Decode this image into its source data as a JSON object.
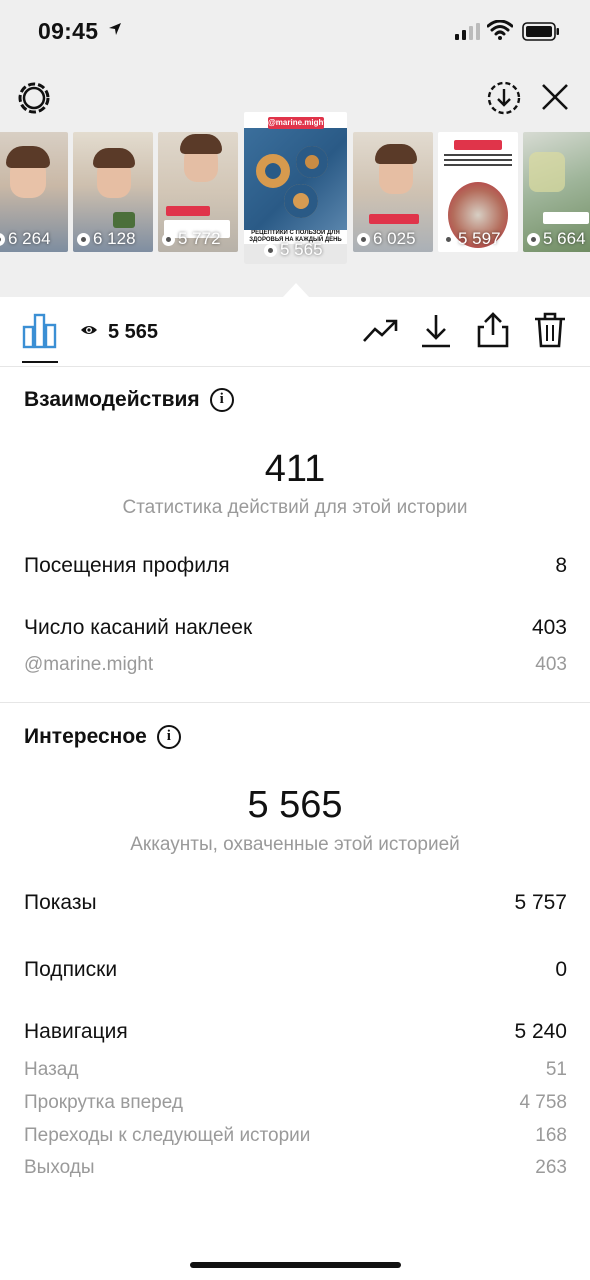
{
  "status_bar": {
    "time": "09:45"
  },
  "stories": [
    {
      "views": "6 264"
    },
    {
      "views": "6 128"
    },
    {
      "views": "5 772"
    },
    {
      "views": "5 565",
      "active": true,
      "tag": "@marine.might",
      "caption": "РЕЦЕПТИКИ С ПОЛЬЗОЙ ДЛЯ ЗДОРОВЬЯ НА КАЖДЫЙ ДЕНЬ"
    },
    {
      "views": "6 025"
    },
    {
      "views": "5 597"
    },
    {
      "views": "5 664"
    }
  ],
  "toolbar": {
    "views_count": "5 565"
  },
  "interactions": {
    "title": "Взаимодействия",
    "total": "411",
    "caption": "Статистика действий для этой истории",
    "rows": [
      {
        "label": "Посещения профиля",
        "value": "8"
      },
      {
        "label": "Число касаний наклеек",
        "value": "403"
      }
    ],
    "sub_rows": [
      {
        "label": "@marine.might",
        "value": "403"
      }
    ]
  },
  "discovery": {
    "title": "Интересное",
    "total": "5 565",
    "caption": "Аккаунты, охваченные этой историей",
    "rows": [
      {
        "label": "Показы",
        "value": "5 757"
      },
      {
        "label": "Подписки",
        "value": "0"
      },
      {
        "label": "Навигация",
        "value": "5 240"
      }
    ],
    "navigation_rows": [
      {
        "label": "Назад",
        "value": "51"
      },
      {
        "label": "Прокрутка вперед",
        "value": "4 758"
      },
      {
        "label": "Переходы к следующей истории",
        "value": "168"
      },
      {
        "label": "Выходы",
        "value": "263"
      }
    ]
  }
}
